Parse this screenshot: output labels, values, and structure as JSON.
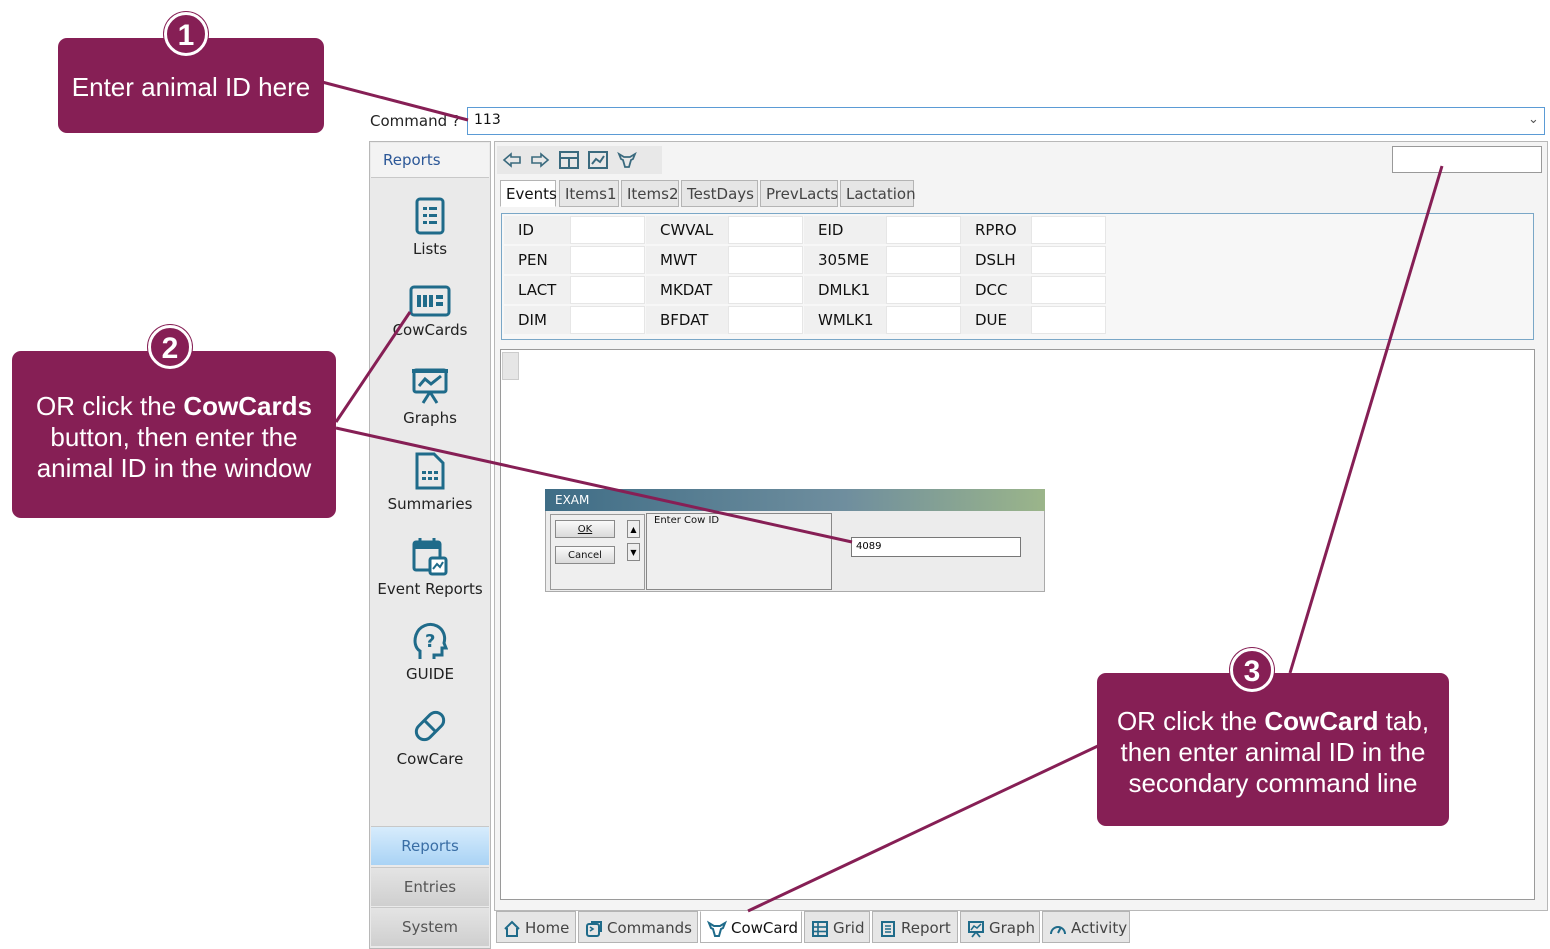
{
  "command": {
    "label": "Command ?",
    "value": "113"
  },
  "sidebar": {
    "header": "Reports",
    "items": [
      {
        "label": "Lists",
        "icon": "list-icon"
      },
      {
        "label": "CowCards",
        "icon": "cowcards-icon"
      },
      {
        "label": "Graphs",
        "icon": "graph-board-icon"
      },
      {
        "label": "Summaries",
        "icon": "summary-document-icon"
      },
      {
        "label": "Event Reports",
        "icon": "calendar-chart-icon"
      },
      {
        "label": "GUIDE",
        "icon": "help-head-icon"
      },
      {
        "label": "CowCare",
        "icon": "pill-icon"
      }
    ],
    "sections": [
      "Reports",
      "Entries",
      "System"
    ]
  },
  "tabs": [
    "Events",
    "Items1",
    "Items2",
    "TestDays",
    "PrevLacts",
    "Lactation"
  ],
  "grid": {
    "columns": [
      [
        "ID",
        "PEN",
        "LACT",
        "DIM"
      ],
      [
        "CWVAL",
        "MWT",
        "MKDAT",
        "BFDAT"
      ],
      [
        "EID",
        "305ME",
        "DMLK1",
        "WMLK1"
      ],
      [
        "RPRO",
        "DSLH",
        "DCC",
        "DUE"
      ]
    ]
  },
  "exam": {
    "title": "EXAM",
    "ok": "OK",
    "cancel": "Cancel",
    "prompt": "Enter Cow ID",
    "value": "4089"
  },
  "bottom_tabs": [
    {
      "label": "Home",
      "icon": "home-icon"
    },
    {
      "label": "Commands",
      "icon": "commands-icon"
    },
    {
      "label": "CowCard",
      "icon": "cow-icon"
    },
    {
      "label": "Grid",
      "icon": "grid-icon"
    },
    {
      "label": "Report",
      "icon": "report-icon"
    },
    {
      "label": "Graph",
      "icon": "graph-icon"
    },
    {
      "label": "Activity",
      "icon": "gauge-icon"
    }
  ],
  "callouts": {
    "c1": {
      "number": "1",
      "text": "Enter animal ID here"
    },
    "c2": {
      "number": "2",
      "pre": "OR click the ",
      "bold": "CowCards",
      "post": " button, then enter the animal ID in the window"
    },
    "c3": {
      "number": "3",
      "pre": "OR click the ",
      "bold": "CowCard",
      "post": " tab, then enter animal ID in the secondary command line"
    }
  },
  "colors": {
    "callout": "#861f55",
    "accent_blue": "#5b9bd5"
  }
}
